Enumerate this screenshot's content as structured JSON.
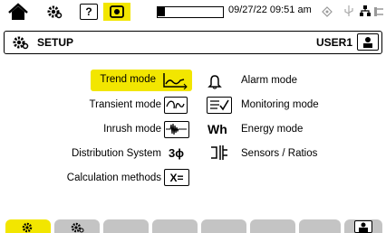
{
  "statusbar": {
    "datetime": "09/27/22 09:51 am",
    "icons": [
      "home-icon",
      "settings-gear-icon",
      "help-icon",
      "camera-icon",
      "battery-icon",
      "sync-icon",
      "usb-icon",
      "plug-icon"
    ]
  },
  "header": {
    "title": "SETUP",
    "user": "USER1",
    "icons": [
      "settings-gear-icon",
      "user-lock-icon"
    ]
  },
  "menu": {
    "trend_mode": "Trend mode",
    "transient_mode": "Transient mode",
    "inrush_mode": "Inrush mode",
    "distribution_system": "Distribution System",
    "calculation_methods": "Calculation methods",
    "alarm_mode": "Alarm mode",
    "monitoring_mode": "Monitoring mode",
    "energy_mode": "Energy mode",
    "sensors_ratios": "Sensors / Ratios",
    "energy_icon_text": "Wh",
    "distribution_icon_text": "3ϕ",
    "calculation_icon_text": "X="
  },
  "colors": {
    "highlight": "#f2e600",
    "tab_inactive": "#c4c4c4"
  }
}
